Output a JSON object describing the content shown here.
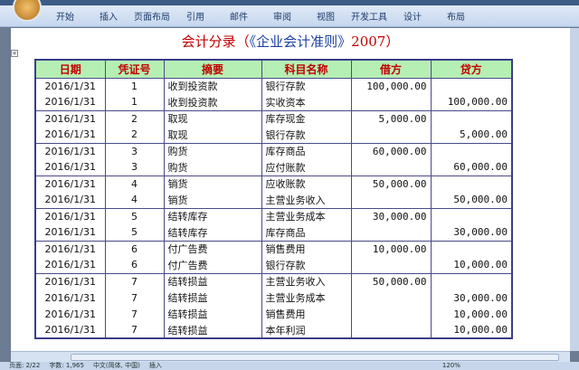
{
  "ribbon": {
    "tabs": [
      "开始",
      "插入",
      "页面布局",
      "引用",
      "邮件",
      "审阅",
      "视图",
      "开发工具",
      "设计",
      "布局"
    ]
  },
  "doc": {
    "title_red1": "会计分录（",
    "title_blue": "《企业会计准则》",
    "title_red2": "2007）"
  },
  "table": {
    "headers": [
      "日期",
      "凭证号",
      "摘要",
      "科目名称",
      "借方",
      "贷方"
    ],
    "rows": [
      [
        "2016/1/31",
        "1",
        "收到投资款",
        "银行存款",
        "100,000.00",
        ""
      ],
      [
        "2016/1/31",
        "1",
        "收到投资款",
        "实收资本",
        "",
        "100,000.00"
      ],
      [
        "2016/1/31",
        "2",
        "取现",
        "库存现金",
        "5,000.00",
        ""
      ],
      [
        "2016/1/31",
        "2",
        "取现",
        "银行存款",
        "",
        "5,000.00"
      ],
      [
        "2016/1/31",
        "3",
        "购货",
        "库存商品",
        "60,000.00",
        ""
      ],
      [
        "2016/1/31",
        "3",
        "购货",
        "应付账款",
        "",
        "60,000.00"
      ],
      [
        "2016/1/31",
        "4",
        "销货",
        "应收账款",
        "50,000.00",
        ""
      ],
      [
        "2016/1/31",
        "4",
        "销货",
        "主营业务收入",
        "",
        "50,000.00"
      ],
      [
        "2016/1/31",
        "5",
        "结转库存",
        "主营业务成本",
        "30,000.00",
        ""
      ],
      [
        "2016/1/31",
        "5",
        "结转库存",
        "库存商品",
        "",
        "30,000.00"
      ],
      [
        "2016/1/31",
        "6",
        "付广告费",
        "销售费用",
        "10,000.00",
        ""
      ],
      [
        "2016/1/31",
        "6",
        "付广告费",
        "银行存款",
        "",
        "10,000.00"
      ],
      [
        "2016/1/31",
        "7",
        "结转损益",
        "主营业务收入",
        "50,000.00",
        ""
      ],
      [
        "2016/1/31",
        "7",
        "结转损益",
        "主营业务成本",
        "",
        "30,000.00"
      ],
      [
        "2016/1/31",
        "7",
        "结转损益",
        "销售费用",
        "",
        "10,000.00"
      ],
      [
        "2016/1/31",
        "7",
        "结转损益",
        "本年利润",
        "",
        "10,000.00"
      ]
    ]
  },
  "status": {
    "page": "页面: 2/22",
    "words": "字数: 1,965",
    "lang": "中文(简体, 中国)",
    "mode": "插入",
    "zoom": "120%"
  }
}
